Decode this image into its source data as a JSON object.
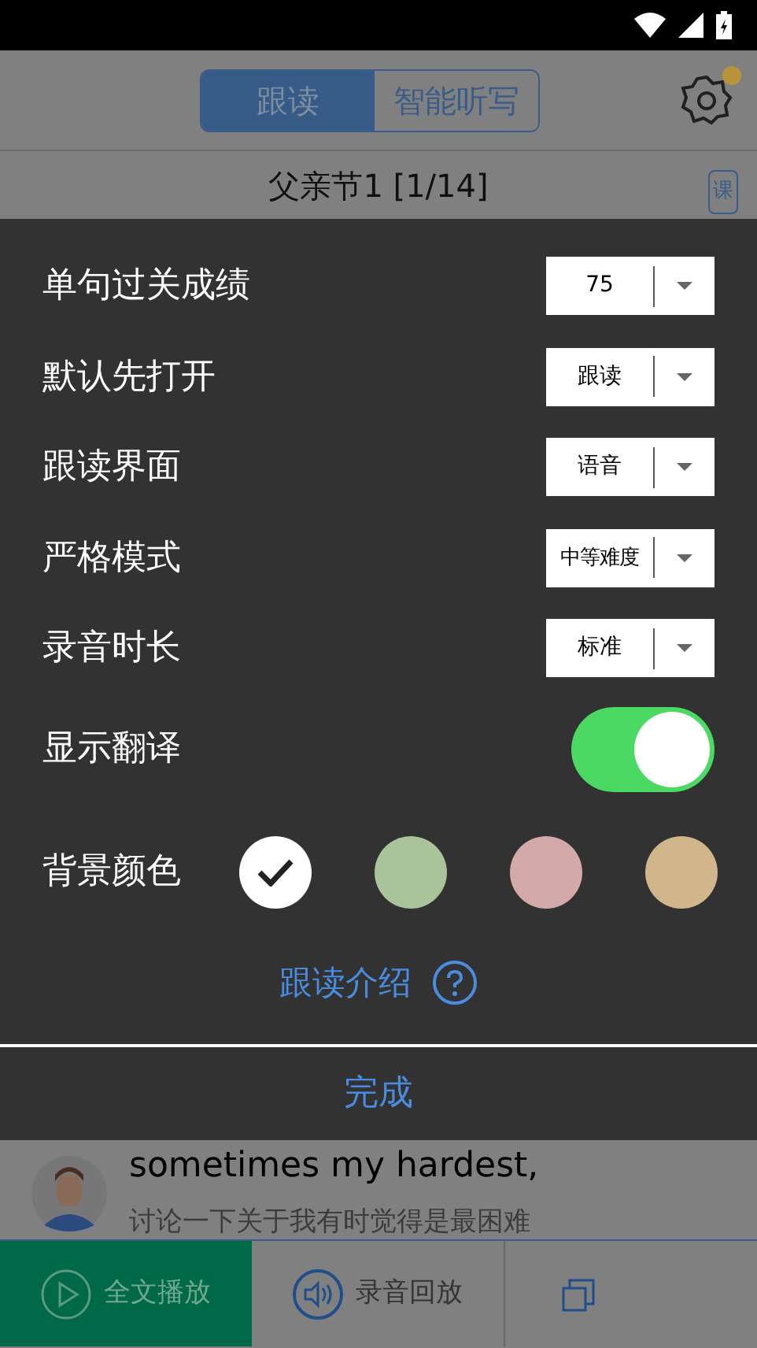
{
  "header": {
    "tabs": [
      {
        "label": "跟读",
        "selected": true
      },
      {
        "label": "智能听写",
        "selected": false
      }
    ],
    "settings_badge": true
  },
  "lesson": {
    "title": "父亲节1  [1/14]",
    "book_label": "课"
  },
  "settings": {
    "rows": [
      {
        "kind": "dropdown",
        "label": "单句过关成绩",
        "value": "75"
      },
      {
        "kind": "dropdown",
        "label": "默认先打开",
        "value": "跟读"
      },
      {
        "kind": "dropdown",
        "label": "跟读界面",
        "value": "语音"
      },
      {
        "kind": "dropdown",
        "label": "严格模式",
        "value": "中等难度"
      },
      {
        "kind": "dropdown",
        "label": "录音时长",
        "value": "标准"
      },
      {
        "kind": "toggle",
        "label": "显示翻译",
        "on": true
      },
      {
        "kind": "colors",
        "label": "背景颜色",
        "colors": [
          {
            "color": "#ffffff",
            "selected": true
          },
          {
            "color": "#a9c39b",
            "selected": false
          },
          {
            "color": "#d4a9a9",
            "selected": false
          },
          {
            "color": "#d2b68b",
            "selected": false
          }
        ]
      }
    ],
    "intro_link": "跟读介绍",
    "done": "完成"
  },
  "sentence": {
    "english": "sometimes my hardest,",
    "chinese": "讨论一下关于我有时觉得是最困难"
  },
  "bottom_bar": [
    {
      "label": "全文播放",
      "selected": true
    },
    {
      "label": "录音回放",
      "selected": false
    }
  ]
}
